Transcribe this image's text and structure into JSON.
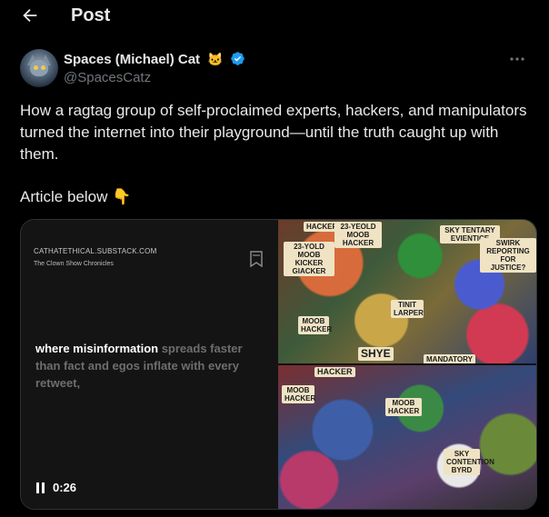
{
  "header": {
    "title": "Post",
    "back_icon": "arrow-left-icon"
  },
  "author": {
    "name": "Spaces (Michael) Cat",
    "name_emoji": "🐱",
    "handle": "@SpacesCatz",
    "verified": true,
    "verified_color": "#1d9bf0"
  },
  "post": {
    "text": "How a ragtag group of self-proclaimed experts, hackers, and manipulators turned the internet into their playground—until the truth caught up with them.",
    "text2": "Article below 👇"
  },
  "media": {
    "source": "CATHATETHICAL.SUBSTACK.COM",
    "publication": "The Clown Show Chronicles",
    "quote_highlight": "where misinformation",
    "quote_rest": " spreads faster than fact and egos inflate with every retweet,",
    "time": "0:26",
    "image_signs": {
      "hacker_top": "HACKER",
      "moob_hacker_top": "23-YEOLD MOOB HACKER",
      "kicker": "23-YOLD MOOB KICKER GIACKER",
      "sky_tentary": "SKY TENTARY EVIENTICE",
      "reporting": "SWIRK REPORTING FOR JUSTICE?",
      "tint_larper": "TINIT LARPER",
      "moob_hacker_mid": "MOOB HACKER",
      "shye": "SHYE",
      "mandatory": "MANDATORY",
      "hacker_bottom": "HACKER",
      "moob_hacker_bottom": "MOOB HACKER",
      "moob_hacker_left": "MOOB HACKER",
      "byrd": "SKY CONTENTION BYRD"
    }
  }
}
